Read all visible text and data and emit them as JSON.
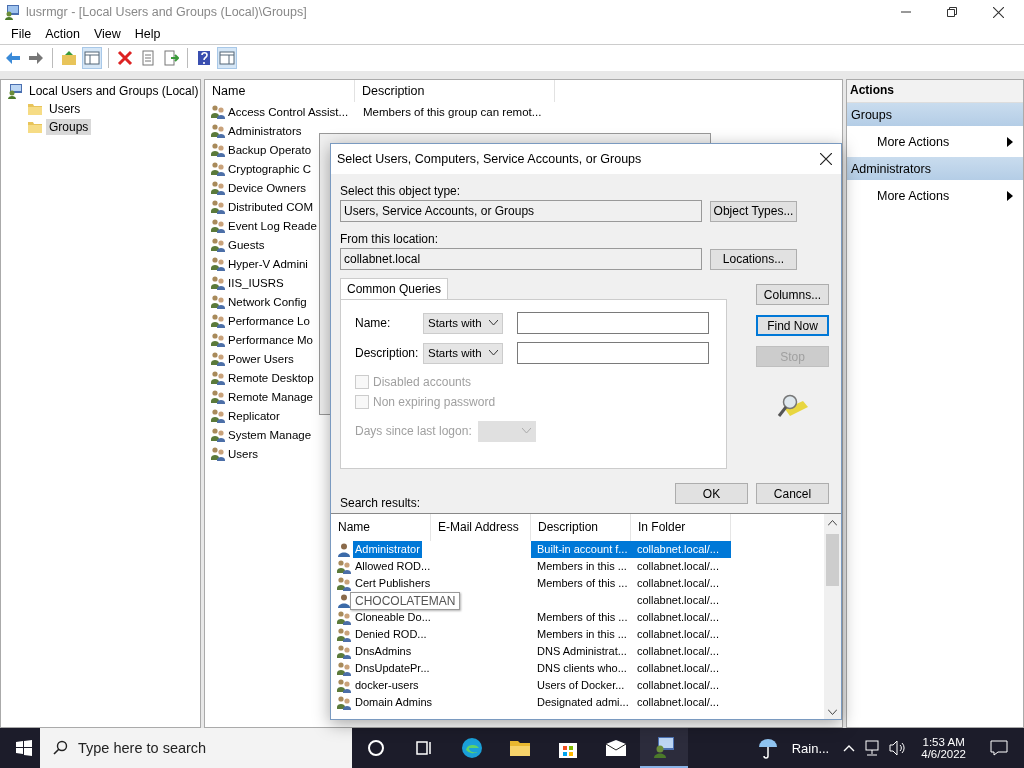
{
  "window": {
    "title": "lusrmgr - [Local Users and Groups (Local)\\Groups]"
  },
  "menu": [
    "File",
    "Action",
    "View",
    "Help"
  ],
  "toolbar": [
    {
      "kind": "back",
      "pressed": false
    },
    {
      "kind": "forward",
      "pressed": false
    },
    {
      "kind": "up",
      "pressed": false
    },
    {
      "kind": "tree",
      "pressed": true
    },
    {
      "kind": "delete",
      "pressed": false
    },
    {
      "kind": "properties",
      "pressed": false
    },
    {
      "kind": "export",
      "pressed": false
    },
    {
      "kind": "help",
      "pressed": false
    },
    {
      "kind": "actionpane",
      "pressed": true
    }
  ],
  "tree": {
    "label": "Local Users and Groups (Local)",
    "children": [
      {
        "label": "Users",
        "selected": false
      },
      {
        "label": "Groups",
        "selected": true
      }
    ]
  },
  "list": {
    "columns": [
      "Name",
      "Description"
    ],
    "rows": [
      {
        "name": "Access Control Assist...",
        "description": "Members of this group can remot..."
      },
      {
        "name": "Administrators"
      },
      {
        "name": "Backup Operato"
      },
      {
        "name": "Cryptographic C"
      },
      {
        "name": "Device Owners"
      },
      {
        "name": "Distributed COM"
      },
      {
        "name": "Event Log Reade"
      },
      {
        "name": "Guests"
      },
      {
        "name": "Hyper-V Admini"
      },
      {
        "name": "IIS_IUSRS"
      },
      {
        "name": "Network Config"
      },
      {
        "name": "Performance Lo"
      },
      {
        "name": "Performance Mo"
      },
      {
        "name": "Power Users"
      },
      {
        "name": "Remote Desktop"
      },
      {
        "name": "Remote Manage"
      },
      {
        "name": "Replicator"
      },
      {
        "name": "System Manage"
      },
      {
        "name": "Users"
      }
    ]
  },
  "actions": {
    "title": "Actions",
    "sections": [
      {
        "title": "Groups",
        "items": [
          "More Actions"
        ]
      },
      {
        "title": "Administrators",
        "items": [
          "More Actions"
        ]
      }
    ]
  },
  "dialog": {
    "title": "Select Users, Computers, Service Accounts, or Groups",
    "object_type_label": "Select this object type:",
    "object_type_value": "Users, Service Accounts, or Groups",
    "object_types_button": "Object Types...",
    "location_label": "From this location:",
    "location_value": "collabnet.local",
    "locations_button": "Locations...",
    "tab": "Common Queries",
    "name_label": "Name:",
    "name_operator": "Starts with",
    "description_label": "Description:",
    "description_operator": "Starts with",
    "checkboxes": [
      {
        "label": "Disabled accounts",
        "checked": false,
        "disabled": true
      },
      {
        "label": "Non expiring password",
        "checked": false,
        "disabled": true
      }
    ],
    "days_label": "Days since last logon:",
    "side_buttons": [
      {
        "label": "Columns...",
        "default": false,
        "disabled": false
      },
      {
        "label": "Find Now",
        "default": true,
        "disabled": false
      },
      {
        "label": "Stop",
        "default": false,
        "disabled": true
      }
    ],
    "ok_button": "OK",
    "cancel_button": "Cancel",
    "results_label": "Search results:",
    "results": {
      "columns": [
        "Name",
        "E-Mail Address",
        "Description",
        "In Folder"
      ],
      "tooltip": "CHOCOLATEMAN",
      "rows": [
        {
          "kind": "user",
          "name": "Administrator",
          "description": "Built-in account f...",
          "folder": "collabnet.local/...",
          "selected": true
        },
        {
          "kind": "group",
          "name": "Allowed ROD...",
          "description": "Members in this ...",
          "folder": "collabnet.local/...",
          "selected": false
        },
        {
          "kind": "group",
          "name": "Cert Publishers",
          "description": "Members of this ...",
          "folder": "collabnet.local/...",
          "selected": false
        },
        {
          "kind": "user",
          "folder": "collabnet.local/...",
          "selected": false
        },
        {
          "kind": "group",
          "name": "Cloneable Do...",
          "description": "Members of this ...",
          "folder": "collabnet.local/...",
          "selected": false
        },
        {
          "kind": "group",
          "name": "Denied ROD...",
          "description": "Members in this ...",
          "folder": "collabnet.local/...",
          "selected": false
        },
        {
          "kind": "group",
          "name": "DnsAdmins",
          "description": "DNS Administrat...",
          "folder": "collabnet.local/...",
          "selected": false
        },
        {
          "kind": "group",
          "name": "DnsUpdatePr...",
          "description": "DNS clients who...",
          "folder": "collabnet.local/...",
          "selected": false
        },
        {
          "kind": "group",
          "name": "docker-users",
          "description": "Users of Docker...",
          "folder": "collabnet.local/...",
          "selected": false
        },
        {
          "kind": "group",
          "name": "Domain Admins",
          "description": "Designated admi...",
          "folder": "collabnet.local/...",
          "selected": false
        }
      ]
    }
  },
  "taskbar": {
    "search_placeholder": "Type here to search",
    "apps": [
      {
        "kind": "cortana",
        "active": false
      },
      {
        "kind": "taskview",
        "active": false
      },
      {
        "kind": "edge",
        "active": false
      },
      {
        "kind": "explorer",
        "active": false
      },
      {
        "kind": "store",
        "active": false
      },
      {
        "kind": "mail",
        "active": false
      },
      {
        "kind": "lusrmgr",
        "active": true
      }
    ],
    "weather": "Rain...",
    "time": "1:53 AM",
    "date": "4/6/2022"
  }
}
